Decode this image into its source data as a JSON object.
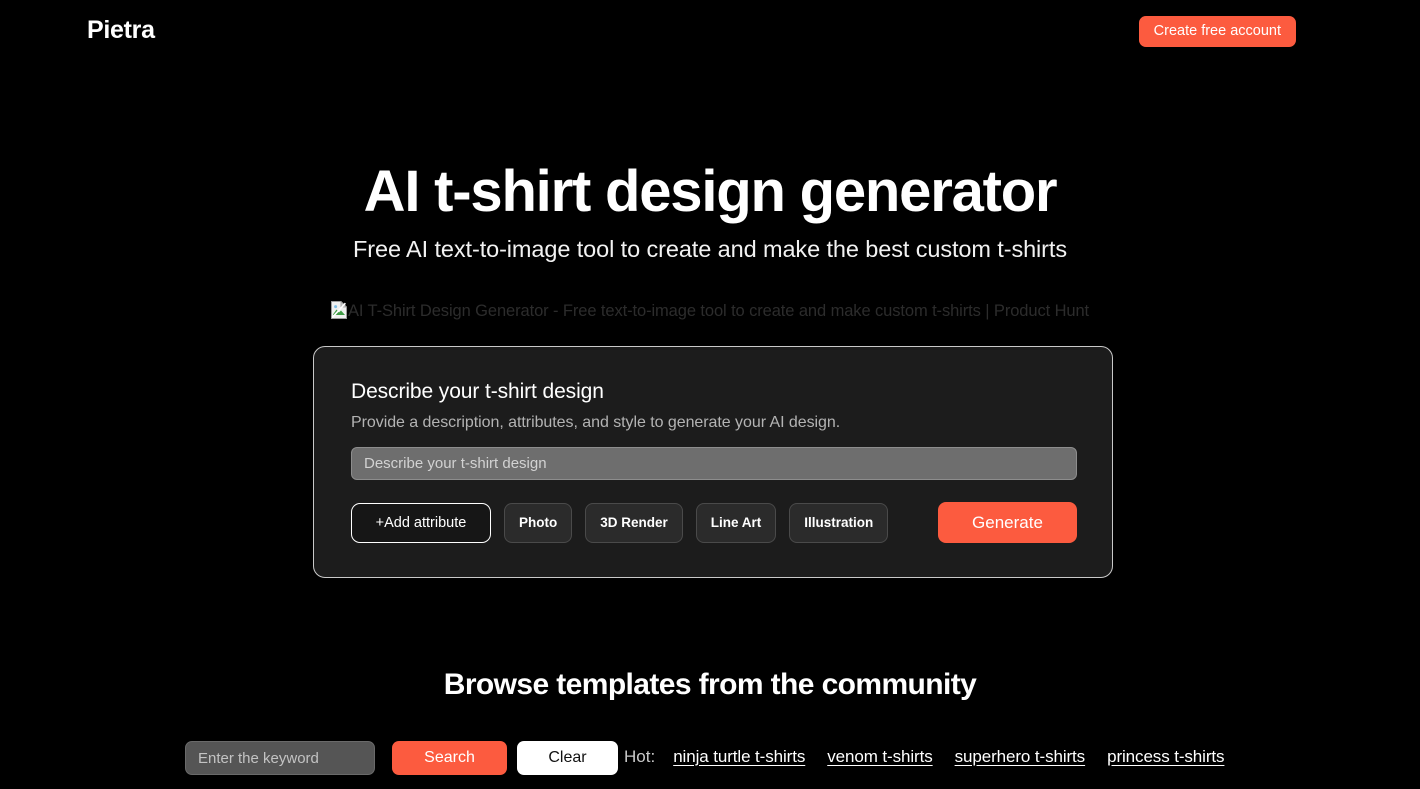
{
  "header": {
    "brand": "Pietra",
    "create_account_label": "Create free account"
  },
  "hero": {
    "title": "AI t-shirt design generator",
    "subtitle": "Free AI text-to-image tool to create and make the best custom t-shirts"
  },
  "product_hunt_badge": {
    "icon": "broken-image-icon",
    "alt_text": "AI T-Shirt Design Generator - Free text-to-image tool to create and make custom t-shirts | Product Hunt"
  },
  "generator_card": {
    "title": "Describe your t-shirt design",
    "subtitle": "Provide a description, attributes, and style to generate your AI design.",
    "prompt_placeholder": "Describe your t-shirt design",
    "prompt_value": "",
    "add_attribute_label": "+Add attribute",
    "style_chips": [
      {
        "label": "Photo"
      },
      {
        "label": "3D Render"
      },
      {
        "label": "Line Art"
      },
      {
        "label": "Illustration"
      }
    ],
    "generate_label": "Generate"
  },
  "browse": {
    "title": "Browse templates from the community",
    "search_placeholder": "Enter the keyword",
    "search_value": "",
    "search_label": "Search",
    "clear_label": "Clear",
    "hot_label": "Hot:",
    "hot_links": [
      {
        "label": "ninja turtle t-shirts"
      },
      {
        "label": "venom t-shirts"
      },
      {
        "label": "superhero t-shirts"
      },
      {
        "label": "princess t-shirts"
      }
    ]
  },
  "colors": {
    "background": "#000000",
    "accent": "#fc5b3f",
    "card_bg": "#1c1c1c",
    "card_border": "#c9c9c9",
    "input_bg": "#6e6e6e"
  }
}
